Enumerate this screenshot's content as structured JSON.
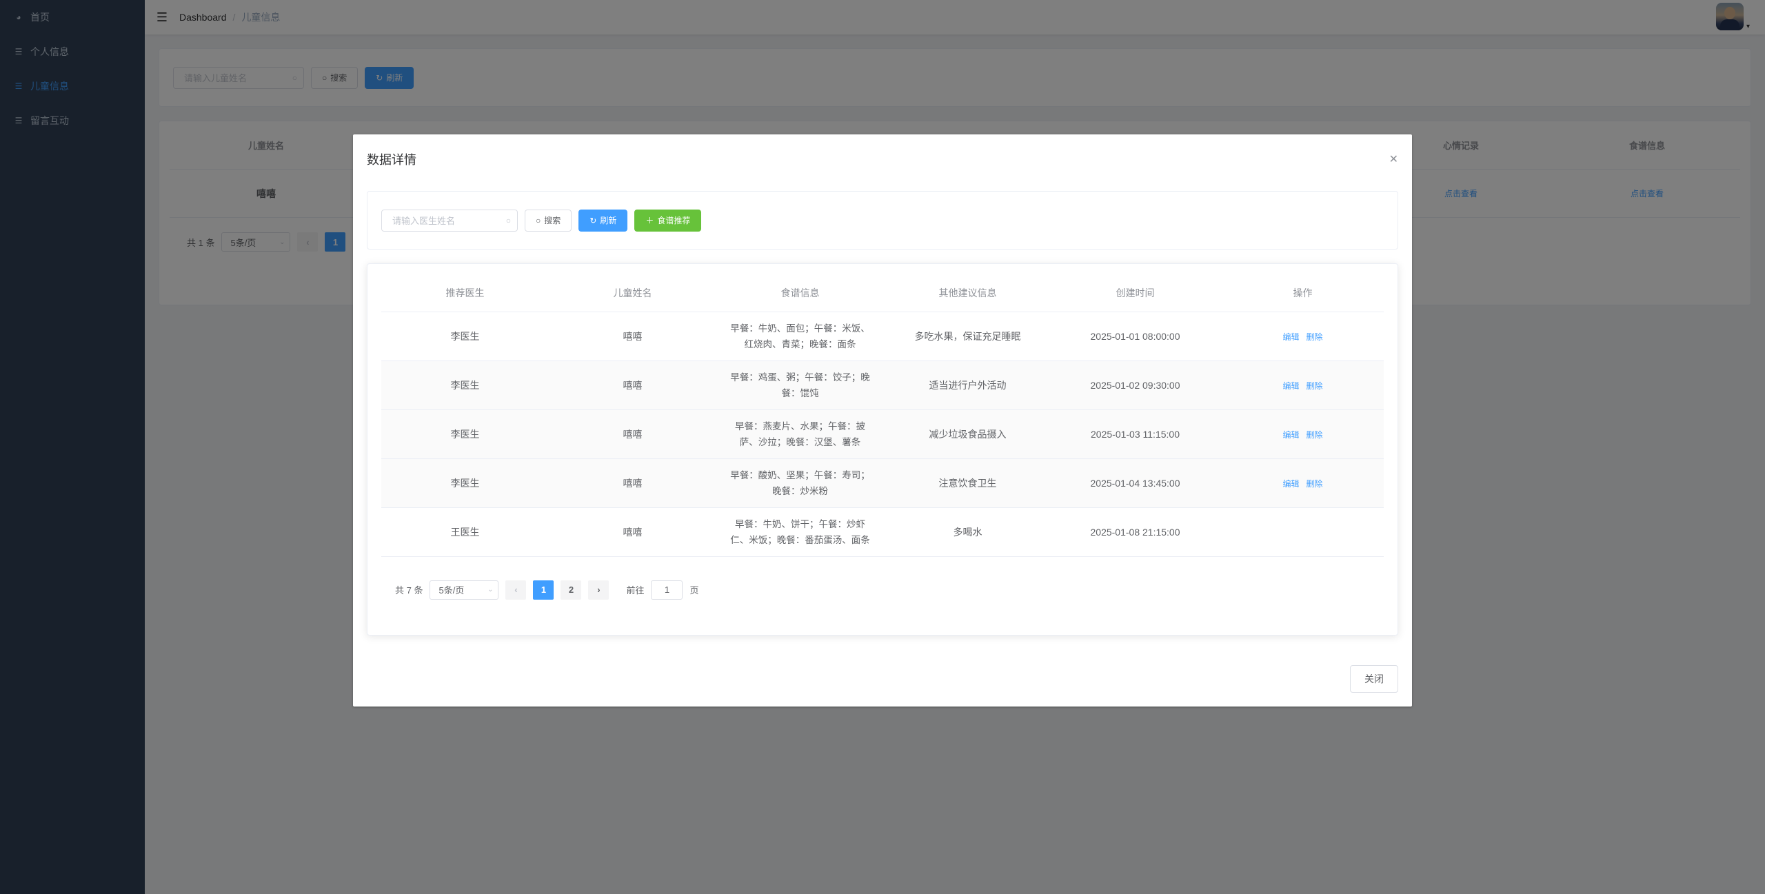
{
  "sidebar": {
    "items": [
      {
        "label": "首页",
        "icon": "dashboard-icon"
      },
      {
        "label": "个人信息",
        "icon": "menu-icon"
      },
      {
        "label": "儿童信息",
        "icon": "menu-icon",
        "active": true
      },
      {
        "label": "留言互动",
        "icon": "menu-icon"
      }
    ]
  },
  "navbar": {
    "breadcrumb": [
      "Dashboard",
      "/",
      "儿童信息"
    ]
  },
  "page": {
    "search_placeholder": "请输入儿童姓名",
    "search_label": "搜索",
    "refresh_label": "刷新",
    "table": {
      "headers": [
        "儿童姓名",
        "",
        "心情记录",
        "食谱信息"
      ],
      "rows": [
        [
          "嘻嘻",
          "",
          "点击查看",
          "点击查看"
        ]
      ]
    },
    "pager": {
      "total": "共 1 条",
      "size": "5条/页",
      "page": "1"
    }
  },
  "dialog": {
    "title": "数据详情",
    "search_placeholder": "请输入医生姓名",
    "search_label": "搜索",
    "refresh_label": "刷新",
    "recommend_label": "食谱推荐",
    "headers": [
      "推荐医生",
      "儿童姓名",
      "食谱信息",
      "其他建议信息",
      "创建时间",
      "操作"
    ],
    "rows": [
      {
        "doctor": "李医生",
        "child": "嘻嘻",
        "food": "早餐：牛奶、面包；午餐：米饭、红烧肉、青菜；晚餐：面条",
        "advice": "多吃水果，保证充足睡眠",
        "time": "2025-01-01 08:00:00",
        "edit": "编辑",
        "del": "删除"
      },
      {
        "doctor": "李医生",
        "child": "嘻嘻",
        "food": "早餐：鸡蛋、粥；午餐：饺子；晚餐：馄饨",
        "advice": "适当进行户外活动",
        "time": "2025-01-02 09:30:00",
        "edit": "编辑",
        "del": "删除"
      },
      {
        "doctor": "李医生",
        "child": "嘻嘻",
        "food": "早餐：燕麦片、水果；午餐：披萨、沙拉；晚餐：汉堡、薯条",
        "advice": "减少垃圾食品摄入",
        "time": "2025-01-03 11:15:00",
        "edit": "编辑",
        "del": "删除"
      },
      {
        "doctor": "李医生",
        "child": "嘻嘻",
        "food": "早餐：酸奶、坚果；午餐：寿司；晚餐：炒米粉",
        "advice": "注意饮食卫生",
        "time": "2025-01-04 13:45:00",
        "edit": "编辑",
        "del": "删除"
      },
      {
        "doctor": "王医生",
        "child": "嘻嘻",
        "food": "早餐：牛奶、饼干；午餐：炒虾仁、米饭；晚餐：番茄蛋汤、面条",
        "advice": "多喝水",
        "time": "2025-01-08 21:15:00",
        "edit": "",
        "del": ""
      }
    ],
    "pager": {
      "total": "共 7 条",
      "size": "5条/页",
      "pages": [
        "1",
        "2"
      ],
      "goto": "前往",
      "goto_value": "1",
      "page_unit": "页"
    },
    "close_label": "关闭"
  },
  "colors": {
    "primary": "#409eff",
    "success": "#67c23a",
    "sidebar": "#304156"
  }
}
